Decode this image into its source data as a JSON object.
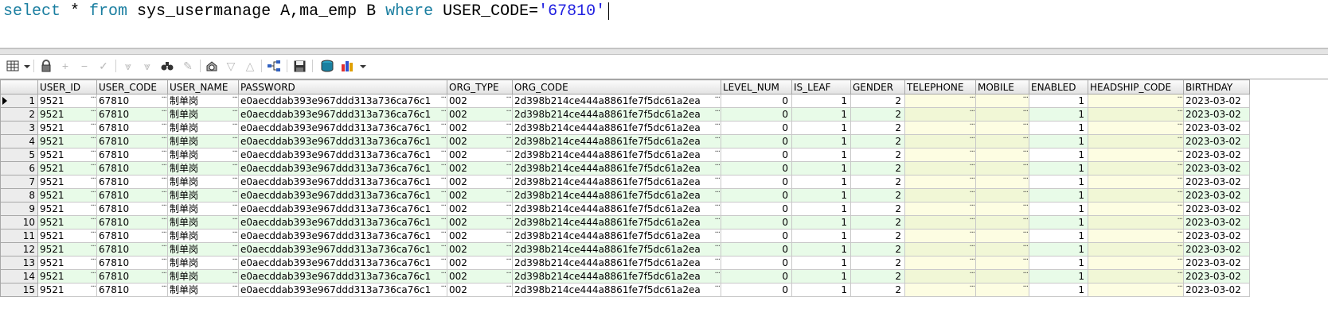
{
  "editor": {
    "kw_select": "select",
    "star": " * ",
    "kw_from": "from",
    "tables": " sys_usermanage A,ma_emp B ",
    "kw_where": "where",
    "condition": " USER_CODE=",
    "value": "'67810'"
  },
  "toolbar": {
    "icons": [
      "grid-menu-icon",
      "lock-icon",
      "add-record-icon",
      "delete-record-icon",
      "post-changes-icon",
      "first-record-icon",
      "last-record-icon",
      "find-icon",
      "clear-icon",
      "query-by-example-icon",
      "filter-icon",
      "previous-icon",
      "export-tree-icon",
      "save-icon",
      "connect-db-icon",
      "chart-icon"
    ]
  },
  "grid": {
    "columns": [
      "USER_ID",
      "USER_CODE",
      "USER_NAME",
      "PASSWORD",
      "ORG_TYPE",
      "ORG_CODE",
      "LEVEL_NUM",
      "IS_LEAF",
      "GENDER",
      "TELEPHONE",
      "MOBILE",
      "ENABLED",
      "HEADSHIP_CODE",
      "BIRTHDAY"
    ],
    "rows": [
      {
        "n": "1",
        "user_id": "9521",
        "user_code": "67810",
        "user_name": "制单岗",
        "password": "e0aecddab393e967ddd313a736ca76c1",
        "org_type": "002",
        "org_code": "2d398b214ce444a8861fe7f5dc61a2ea",
        "level_num": "0",
        "is_leaf": "1",
        "gender": "2",
        "telephone": "",
        "mobile": "",
        "enabled": "1",
        "headship_code": "",
        "birthday": "2023-03-02"
      },
      {
        "n": "2",
        "user_id": "9521",
        "user_code": "67810",
        "user_name": "制单岗",
        "password": "e0aecddab393e967ddd313a736ca76c1",
        "org_type": "002",
        "org_code": "2d398b214ce444a8861fe7f5dc61a2ea",
        "level_num": "0",
        "is_leaf": "1",
        "gender": "2",
        "telephone": "",
        "mobile": "",
        "enabled": "1",
        "headship_code": "",
        "birthday": "2023-03-02"
      },
      {
        "n": "3",
        "user_id": "9521",
        "user_code": "67810",
        "user_name": "制单岗",
        "password": "e0aecddab393e967ddd313a736ca76c1",
        "org_type": "002",
        "org_code": "2d398b214ce444a8861fe7f5dc61a2ea",
        "level_num": "0",
        "is_leaf": "1",
        "gender": "2",
        "telephone": "",
        "mobile": "",
        "enabled": "1",
        "headship_code": "",
        "birthday": "2023-03-02"
      },
      {
        "n": "4",
        "user_id": "9521",
        "user_code": "67810",
        "user_name": "制单岗",
        "password": "e0aecddab393e967ddd313a736ca76c1",
        "org_type": "002",
        "org_code": "2d398b214ce444a8861fe7f5dc61a2ea",
        "level_num": "0",
        "is_leaf": "1",
        "gender": "2",
        "telephone": "",
        "mobile": "",
        "enabled": "1",
        "headship_code": "",
        "birthday": "2023-03-02"
      },
      {
        "n": "5",
        "user_id": "9521",
        "user_code": "67810",
        "user_name": "制单岗",
        "password": "e0aecddab393e967ddd313a736ca76c1",
        "org_type": "002",
        "org_code": "2d398b214ce444a8861fe7f5dc61a2ea",
        "level_num": "0",
        "is_leaf": "1",
        "gender": "2",
        "telephone": "",
        "mobile": "",
        "enabled": "1",
        "headship_code": "",
        "birthday": "2023-03-02"
      },
      {
        "n": "6",
        "user_id": "9521",
        "user_code": "67810",
        "user_name": "制单岗",
        "password": "e0aecddab393e967ddd313a736ca76c1",
        "org_type": "002",
        "org_code": "2d398b214ce444a8861fe7f5dc61a2ea",
        "level_num": "0",
        "is_leaf": "1",
        "gender": "2",
        "telephone": "",
        "mobile": "",
        "enabled": "1",
        "headship_code": "",
        "birthday": "2023-03-02"
      },
      {
        "n": "7",
        "user_id": "9521",
        "user_code": "67810",
        "user_name": "制单岗",
        "password": "e0aecddab393e967ddd313a736ca76c1",
        "org_type": "002",
        "org_code": "2d398b214ce444a8861fe7f5dc61a2ea",
        "level_num": "0",
        "is_leaf": "1",
        "gender": "2",
        "telephone": "",
        "mobile": "",
        "enabled": "1",
        "headship_code": "",
        "birthday": "2023-03-02"
      },
      {
        "n": "8",
        "user_id": "9521",
        "user_code": "67810",
        "user_name": "制单岗",
        "password": "e0aecddab393e967ddd313a736ca76c1",
        "org_type": "002",
        "org_code": "2d398b214ce444a8861fe7f5dc61a2ea",
        "level_num": "0",
        "is_leaf": "1",
        "gender": "2",
        "telephone": "",
        "mobile": "",
        "enabled": "1",
        "headship_code": "",
        "birthday": "2023-03-02"
      },
      {
        "n": "9",
        "user_id": "9521",
        "user_code": "67810",
        "user_name": "制单岗",
        "password": "e0aecddab393e967ddd313a736ca76c1",
        "org_type": "002",
        "org_code": "2d398b214ce444a8861fe7f5dc61a2ea",
        "level_num": "0",
        "is_leaf": "1",
        "gender": "2",
        "telephone": "",
        "mobile": "",
        "enabled": "1",
        "headship_code": "",
        "birthday": "2023-03-02"
      },
      {
        "n": "10",
        "user_id": "9521",
        "user_code": "67810",
        "user_name": "制单岗",
        "password": "e0aecddab393e967ddd313a736ca76c1",
        "org_type": "002",
        "org_code": "2d398b214ce444a8861fe7f5dc61a2ea",
        "level_num": "0",
        "is_leaf": "1",
        "gender": "2",
        "telephone": "",
        "mobile": "",
        "enabled": "1",
        "headship_code": "",
        "birthday": "2023-03-02"
      },
      {
        "n": "11",
        "user_id": "9521",
        "user_code": "67810",
        "user_name": "制单岗",
        "password": "e0aecddab393e967ddd313a736ca76c1",
        "org_type": "002",
        "org_code": "2d398b214ce444a8861fe7f5dc61a2ea",
        "level_num": "0",
        "is_leaf": "1",
        "gender": "2",
        "telephone": "",
        "mobile": "",
        "enabled": "1",
        "headship_code": "",
        "birthday": "2023-03-02"
      },
      {
        "n": "12",
        "user_id": "9521",
        "user_code": "67810",
        "user_name": "制单岗",
        "password": "e0aecddab393e967ddd313a736ca76c1",
        "org_type": "002",
        "org_code": "2d398b214ce444a8861fe7f5dc61a2ea",
        "level_num": "0",
        "is_leaf": "1",
        "gender": "2",
        "telephone": "",
        "mobile": "",
        "enabled": "1",
        "headship_code": "",
        "birthday": "2023-03-02"
      },
      {
        "n": "13",
        "user_id": "9521",
        "user_code": "67810",
        "user_name": "制单岗",
        "password": "e0aecddab393e967ddd313a736ca76c1",
        "org_type": "002",
        "org_code": "2d398b214ce444a8861fe7f5dc61a2ea",
        "level_num": "0",
        "is_leaf": "1",
        "gender": "2",
        "telephone": "",
        "mobile": "",
        "enabled": "1",
        "headship_code": "",
        "birthday": "2023-03-02"
      },
      {
        "n": "14",
        "user_id": "9521",
        "user_code": "67810",
        "user_name": "制单岗",
        "password": "e0aecddab393e967ddd313a736ca76c1",
        "org_type": "002",
        "org_code": "2d398b214ce444a8861fe7f5dc61a2ea",
        "level_num": "0",
        "is_leaf": "1",
        "gender": "2",
        "telephone": "",
        "mobile": "",
        "enabled": "1",
        "headship_code": "",
        "birthday": "2023-03-02"
      },
      {
        "n": "15",
        "user_id": "9521",
        "user_code": "67810",
        "user_name": "制单岗",
        "password": "e0aecddab393e967ddd313a736ca76c1",
        "org_type": "002",
        "org_code": "2d398b214ce444a8861fe7f5dc61a2ea",
        "level_num": "0",
        "is_leaf": "1",
        "gender": "2",
        "telephone": "",
        "mobile": "",
        "enabled": "1",
        "headship_code": "",
        "birthday": "2023-03-02"
      }
    ]
  }
}
